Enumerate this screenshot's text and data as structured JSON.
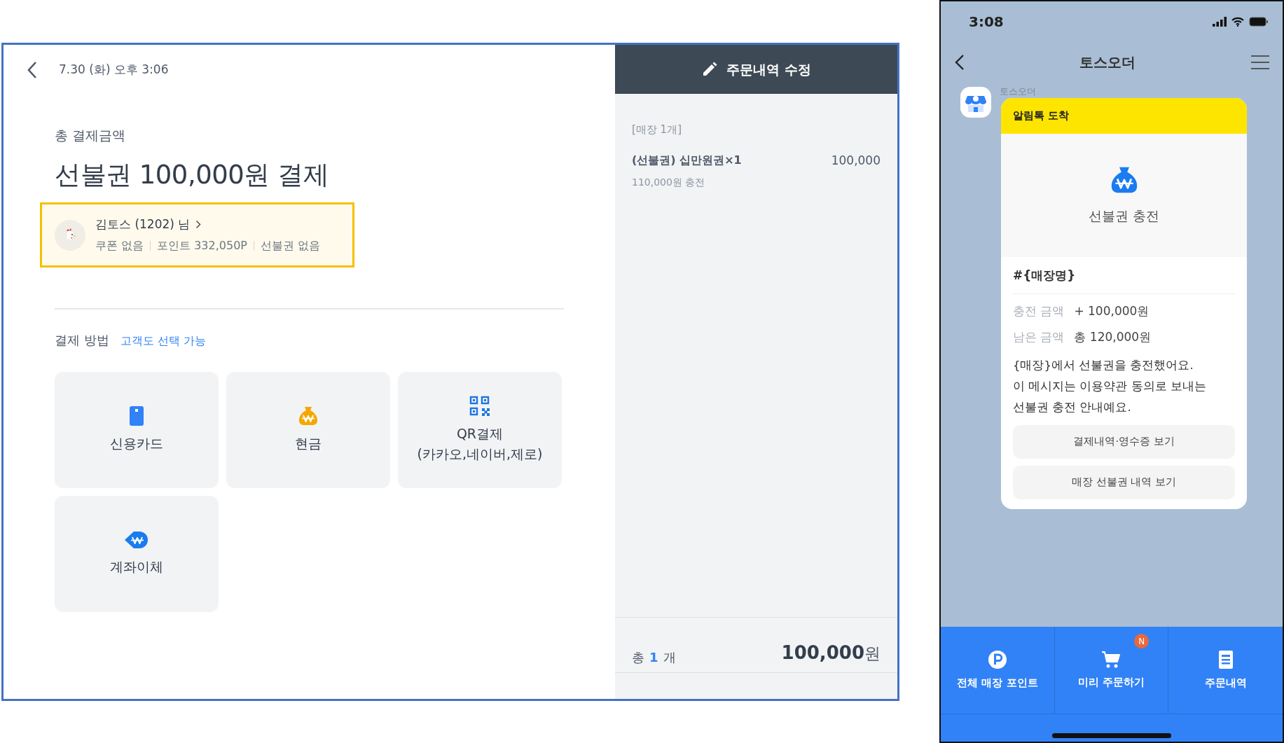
{
  "order_screen": {
    "datetime": "7.30 (화) 오후 3:06",
    "total_label": "총 결제금액",
    "title": "선불권 100,000원 결제",
    "customer": {
      "name": "김토스 (1202) 님",
      "highlighted": true,
      "stats": [
        "쿠폰 없음",
        "포인트 332,050P",
        "선불권 없음"
      ]
    },
    "payment_section": {
      "label": "결제 방법",
      "hint": "고객도 선택 가능"
    },
    "payment_methods": [
      {
        "kind": "card",
        "label": "신용카드"
      },
      {
        "kind": "cash",
        "label": "현금"
      },
      {
        "kind": "qr",
        "label": "QR결제\n(카카오,네이버,제로)"
      },
      {
        "kind": "transfer",
        "label": "계좌이체"
      }
    ]
  },
  "order_panel": {
    "edit_button": "주문내역 수정",
    "store_label": "[매장 1개]",
    "items": [
      {
        "name": "(선불권) 십만원권×1",
        "price": "100,000",
        "note": "110,000원 충전"
      }
    ],
    "total": {
      "prefix": "총",
      "count": "1",
      "suffix": "개",
      "amount": "100,000",
      "currency": "원"
    }
  },
  "phone": {
    "status_time": "3:08",
    "title": "토스오더",
    "sender": "토스오더",
    "message": {
      "header": "알림톡 도착",
      "hero_title": "선불권 충전",
      "store": "#{매장명}",
      "details": [
        {
          "label": "충전 금액",
          "value": "+ 100,000원"
        },
        {
          "label": "남은 금액",
          "value": "총 120,000원"
        }
      ],
      "body": "{매장}에서 선불권을 충전했어요.\n이 메시지는 이용약관 동의로 보내는\n선불권 충전 안내예요.",
      "buttons": [
        "결제내역·영수증 보기",
        "매장 선불권 내역 보기"
      ]
    },
    "tabs": [
      {
        "kind": "points",
        "label": "전체 매장 포인트"
      },
      {
        "kind": "cart",
        "label": "미리 주문하기",
        "badge": "N"
      },
      {
        "kind": "orders",
        "label": "주문내역"
      }
    ]
  }
}
